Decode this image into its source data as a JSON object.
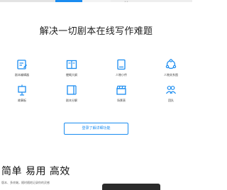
{
  "colors": {
    "accent": "#1a8cf0",
    "text": "#222222",
    "icon": "#1a8cf0"
  },
  "hero": {
    "title": "解决一切剧本在线写作难题"
  },
  "features": [
    {
      "icon": "script-editor-icon",
      "label": "剧本编辑器"
    },
    {
      "icon": "story-outline-icon",
      "label": "梗概大纲"
    },
    {
      "icon": "character-bio-icon",
      "label": "人物小传"
    },
    {
      "icon": "character-relations-icon",
      "label": "人物关系图"
    },
    {
      "icon": "storyboard-icon",
      "label": "故事板"
    },
    {
      "icon": "script-breakdown-icon",
      "label": "剧本分解"
    },
    {
      "icon": "scene-table-icon",
      "label": "场景表"
    },
    {
      "icon": "team-icon",
      "label": "团队"
    }
  ],
  "cta": {
    "label": "登录了解详细功能"
  },
  "promo": {
    "tagline": "简单 易用 高效",
    "subtitle": "版本、多终端，随时随地记录你的灵感"
  }
}
